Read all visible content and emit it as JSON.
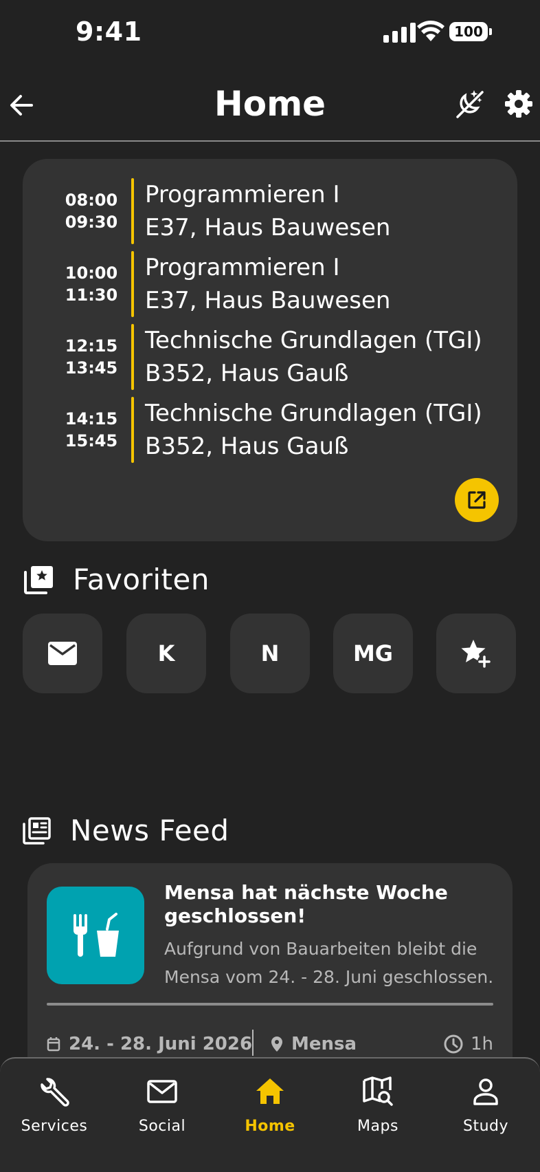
{
  "status_bar": {
    "time": "9:41",
    "battery": "100"
  },
  "header": {
    "title": "Home"
  },
  "schedule": {
    "lectures": [
      {
        "start": "08:00",
        "end": "09:30",
        "course": "Programmieren I",
        "room": "E37, Haus Bauwesen"
      },
      {
        "start": "10:00",
        "end": "11:30",
        "course": "Programmieren I",
        "room": "E37, Haus Bauwesen"
      },
      {
        "start": "12:15",
        "end": "13:45",
        "course": "Technische Grundlagen (TGI)",
        "room": "B352, Haus Gauß"
      },
      {
        "start": "14:15",
        "end": "15:45",
        "course": "Technische Grundlagen (TGI)",
        "room": "B352, Haus Gauß"
      }
    ]
  },
  "favorites": {
    "title": "Favoriten",
    "items": [
      {
        "icon": "mail-icon",
        "label": ""
      },
      {
        "label": "K"
      },
      {
        "label": "N"
      },
      {
        "label": "MG"
      },
      {
        "icon": "add-star-icon",
        "label": ""
      }
    ]
  },
  "news": {
    "title": "News Feed",
    "items": [
      {
        "headline": "Mensa hat nächste Woche geschlossen!",
        "text": "Aufgrund von Bauarbeiten bleibt die Mensa vom 24. - 28. Juni geschlossen.",
        "date": "24. - 28. Juni 2026",
        "location": "Mensa",
        "duration": "1h"
      }
    ]
  },
  "nav": {
    "items": [
      {
        "label": "Services"
      },
      {
        "label": "Social"
      },
      {
        "label": "Home"
      },
      {
        "label": "Maps"
      },
      {
        "label": "Study"
      }
    ],
    "active": "Home"
  },
  "colors": {
    "accent": "#f5c400",
    "background": "#222222",
    "card": "#333333",
    "news_thumb": "#00a2b0"
  }
}
